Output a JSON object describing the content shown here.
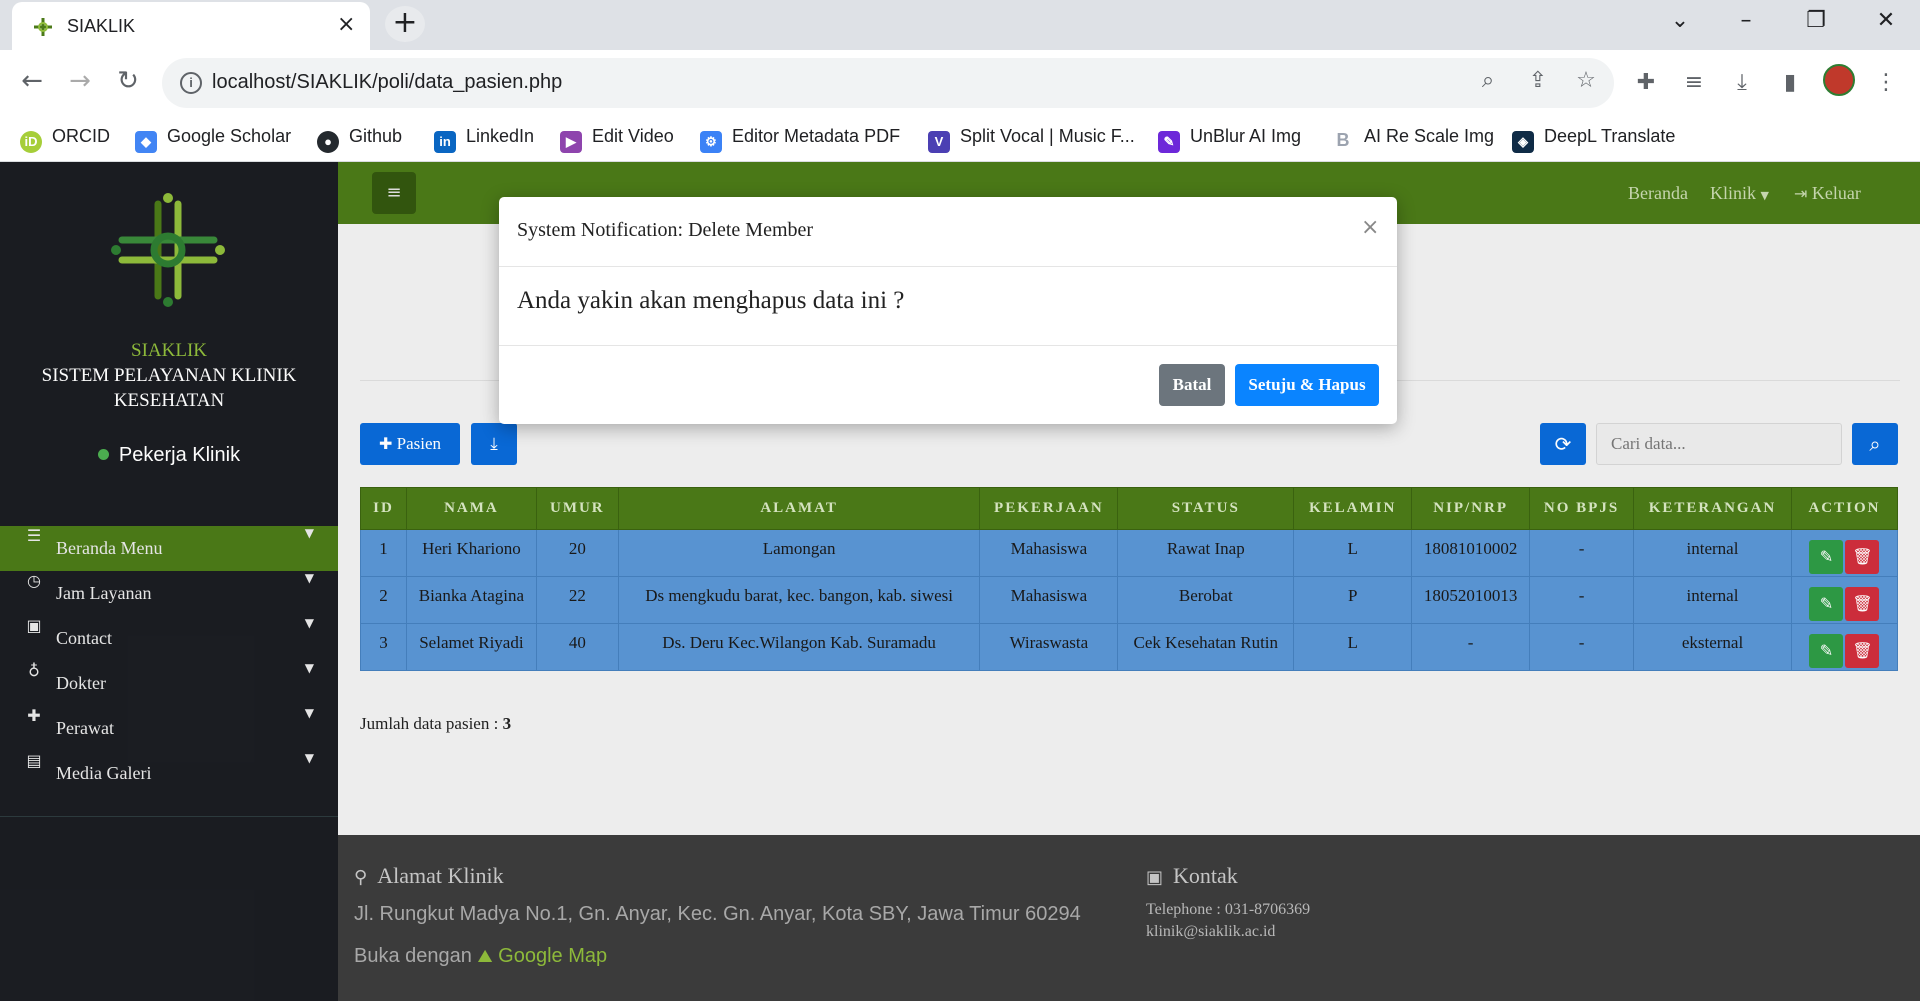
{
  "browser": {
    "tab_title": "SIAKLIK",
    "url": "localhost/SIAKLIK/poli/data_pasien.php",
    "bookmarks": [
      {
        "label": "ORCID",
        "icon": "orcid-icon",
        "color": "#a6ce39"
      },
      {
        "label": "Google Scholar",
        "icon": "scholar-icon",
        "color": "#4285f4"
      },
      {
        "label": "Github",
        "icon": "github-icon",
        "color": "#24292e"
      },
      {
        "label": "LinkedIn",
        "icon": "linkedin-icon",
        "color": "#0a66c2"
      },
      {
        "label": "Edit Video",
        "icon": "video-icon",
        "color": "#8e44ad"
      },
      {
        "label": "Editor Metadata PDF",
        "icon": "pdf-icon",
        "color": "#3b82f6"
      },
      {
        "label": "Split Vocal | Music F...",
        "icon": "vocal-icon",
        "color": "#4b3fb3"
      },
      {
        "label": "UnBlur AI Img",
        "icon": "unblur-icon",
        "color": "#6d28d9"
      },
      {
        "label": "AI Re Scale Img",
        "icon": "rescale-icon",
        "color": "#9ca3af"
      },
      {
        "label": "DeepL Translate",
        "icon": "deepl-icon",
        "color": "#0f2b46"
      }
    ]
  },
  "sidebar": {
    "brand_name": "SIAKLIK",
    "brand_line1": "SISTEM PELAYANAN KLINIK",
    "brand_line2": "KESEHATAN",
    "role": "Pekerja Klinik",
    "menu": [
      {
        "label": "Beranda Menu",
        "icon": "list-icon",
        "active": true
      },
      {
        "label": "Jam Layanan",
        "icon": "clock-icon",
        "active": false
      },
      {
        "label": "Contact",
        "icon": "contact-icon",
        "active": false
      },
      {
        "label": "Dokter",
        "icon": "stethoscope-icon",
        "active": false
      },
      {
        "label": "Perawat",
        "icon": "medkit-icon",
        "active": false
      },
      {
        "label": "Media Galeri",
        "icon": "gallery-icon",
        "active": false
      }
    ]
  },
  "topnav": {
    "home": "Beranda",
    "clinic": "Klinik",
    "logout": "Keluar"
  },
  "toolbar": {
    "add_label": "Pasien",
    "search_placeholder": "Cari data..."
  },
  "table": {
    "headers": [
      "ID",
      "NAMA",
      "UMUR",
      "ALAMAT",
      "PEKERJAAN",
      "STATUS",
      "KELAMIN",
      "NIP/NRP",
      "NO BPJS",
      "KETERANGAN",
      "ACTION"
    ],
    "rows": [
      [
        "1",
        "Heri Khariono",
        "20",
        "Lamongan",
        "Mahasiswa",
        "Rawat Inap",
        "L",
        "18081010002",
        "-",
        "internal"
      ],
      [
        "2",
        "Bianka Atagina",
        "22",
        "Ds mengkudu barat, kec. bangon, kab. siwesi",
        "Mahasiswa",
        "Berobat",
        "P",
        "18052010013",
        "-",
        "internal"
      ],
      [
        "3",
        "Selamet Riyadi",
        "40",
        "Ds. Deru Kec.Wilangon Kab. Suramadu",
        "Wiraswasta",
        "Cek Kesehatan Rutin",
        "L",
        "-",
        "-",
        "eksternal"
      ]
    ]
  },
  "summary": {
    "label": "Jumlah data pasien : ",
    "count": "3"
  },
  "footer": {
    "address_title": "Alamat Klinik",
    "address": "Jl. Rungkut Madya No.1, Gn. Anyar, Kec. Gn. Anyar, Kota SBY, Jawa Timur 60294",
    "map_prefix": "Buka dengan",
    "map_link": "Google Map",
    "contact_title": "Kontak",
    "telephone": "Telephone : 031-8706369",
    "email": "klinik@siaklik.ac.id"
  },
  "modal": {
    "title": "System Notification: Delete Member",
    "message": "Anda yakin akan menghapus data ini ?",
    "cancel_label": "Batal",
    "confirm_label": "Setuju & Hapus"
  },
  "colors": {
    "primary_green": "#4b7a18",
    "sidebar_bg": "#1b1d22",
    "button_blue": "#0a6ad8",
    "table_row": "#5a95d4"
  }
}
